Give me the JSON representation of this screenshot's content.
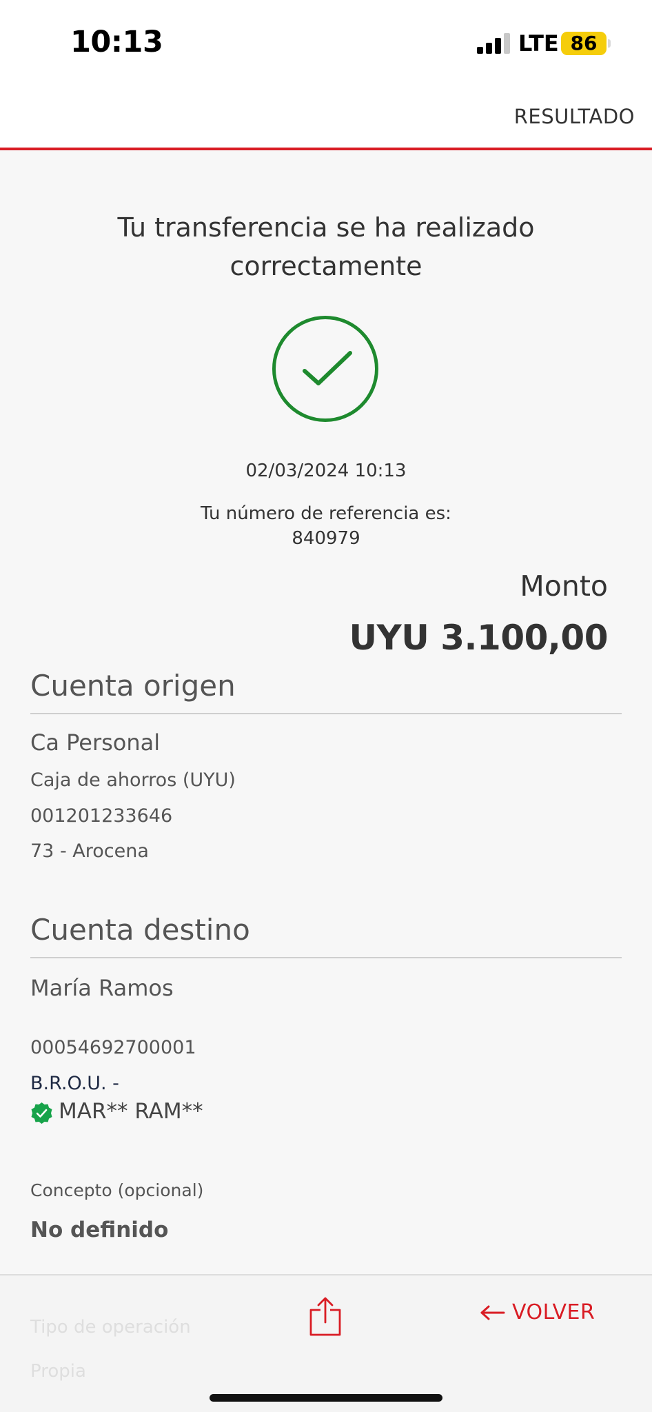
{
  "status_bar": {
    "time": "10:13",
    "network": "LTE",
    "battery": "86",
    "icons": [
      "signal-icon",
      "battery-icon"
    ]
  },
  "header": {
    "title": "RESULTADO"
  },
  "result": {
    "message": "Tu transferencia se ha realizado correctamente",
    "icon": "check-circle-icon",
    "datetime": "02/03/2024 10:13",
    "reference_label": "Tu número de referencia es:",
    "reference_number": "840979",
    "amount_label": "Monto",
    "amount_value": "UYU 3.100,00"
  },
  "origin": {
    "title": "Cuenta origen",
    "name": "Ca Personal",
    "type": "Caja de ahorros (UYU)",
    "number": "001201233646",
    "branch": "73 - Arocena"
  },
  "destination": {
    "title": "Cuenta destino",
    "name": "María Ramos",
    "number": "00054692700001",
    "bank": "B.R.O.U. -",
    "holder": "MAR** RAM**"
  },
  "concept": {
    "label": "Concepto (opcional)",
    "value": "No definido"
  },
  "bottom": {
    "ghost_label_1": "Tipo de operación",
    "ghost_label_2": "Propia",
    "back_label": "VOLVER",
    "icons": [
      "share-icon",
      "arrow-left-icon"
    ]
  },
  "colors": {
    "accent": "#d91c24",
    "success": "#1e8a2e",
    "verified": "#17a34a",
    "battery": "#f5cd0b"
  }
}
